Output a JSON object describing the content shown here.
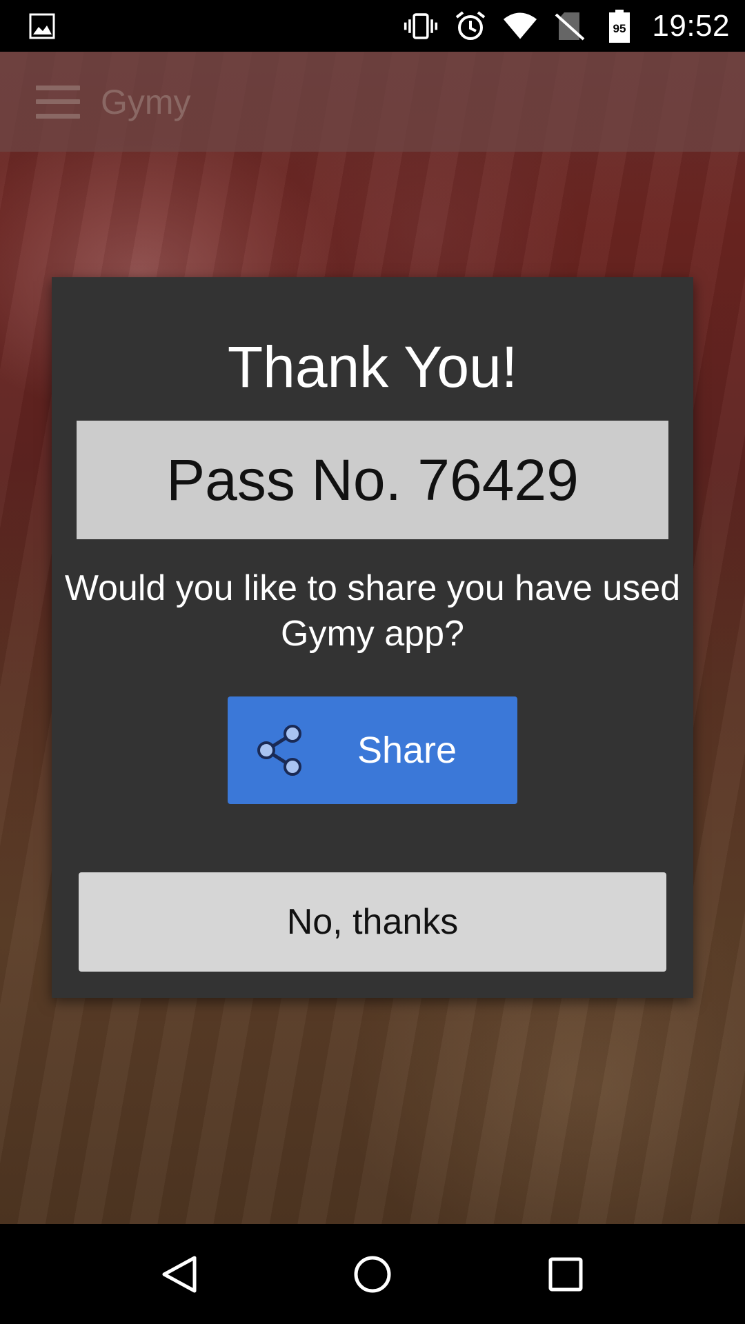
{
  "status_bar": {
    "time": "19:52",
    "battery_level": "95",
    "icons": [
      "gallery-icon",
      "vibrate-icon",
      "alarm-icon",
      "wifi-icon",
      "no-sim-icon",
      "battery-icon"
    ]
  },
  "app_bar": {
    "title": "Gymy",
    "menu_icon": "hamburger-menu-icon"
  },
  "dialog": {
    "title": "Thank You!",
    "pass_text": "Pass No. 76429",
    "question": "Would you like to share you have used Gymy app?",
    "share_button_label": "Share",
    "share_icon": "share-icon",
    "no_thanks_label": "No, thanks"
  },
  "nav_bar": {
    "back_icon": "back-icon",
    "home_icon": "home-icon",
    "recents_icon": "recents-icon"
  },
  "colors": {
    "dialog_bg": "#333333",
    "pass_box_bg": "#cccccc",
    "share_button_bg": "#3b78d8",
    "no_thanks_bg": "#d6d6d6"
  }
}
